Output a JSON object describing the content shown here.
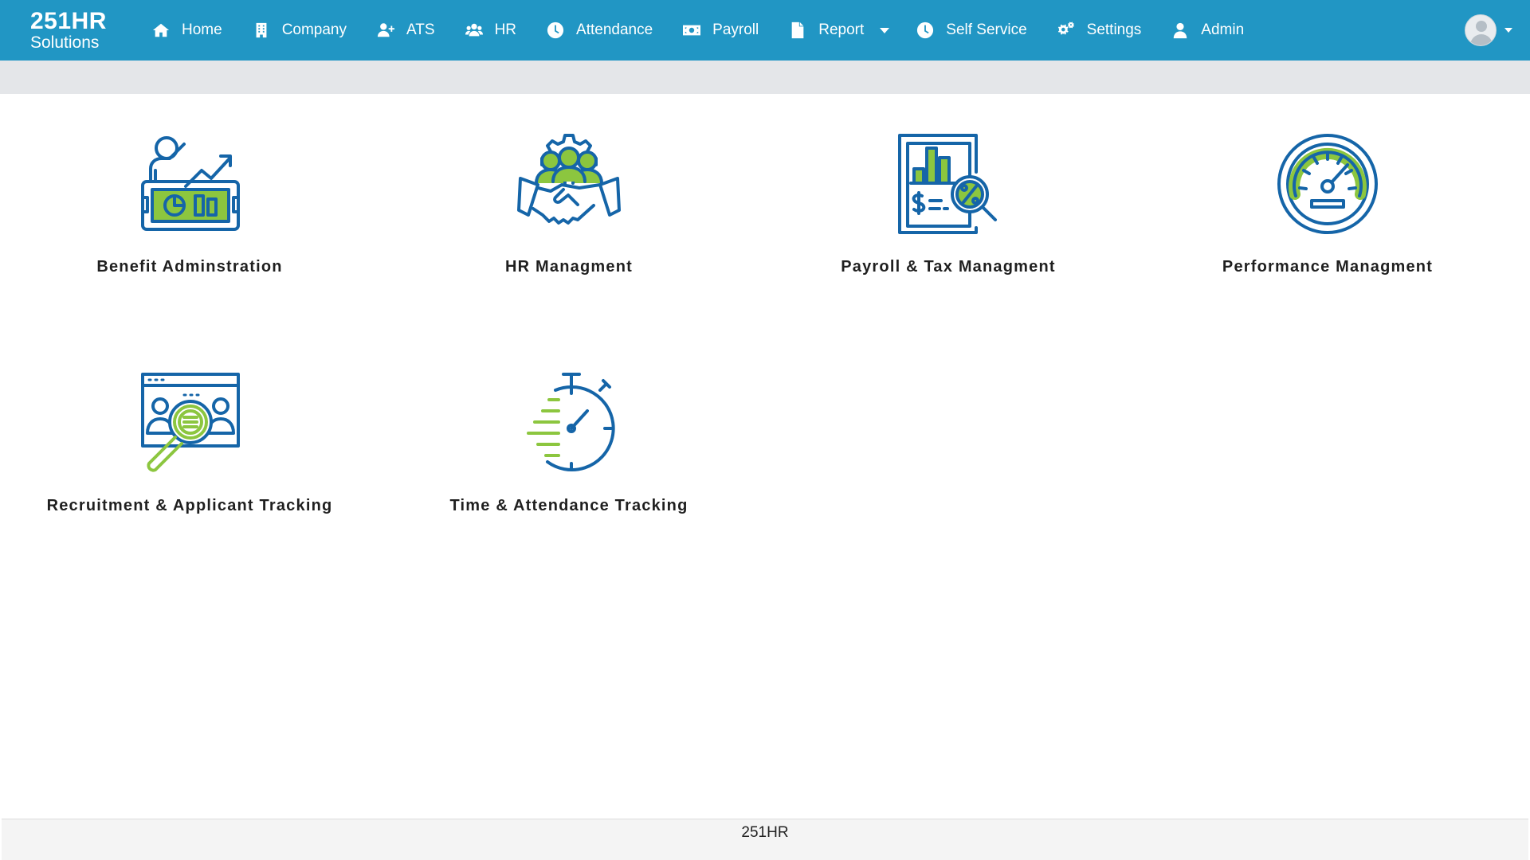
{
  "brand": {
    "line1": "251HR",
    "line2": "Solutions"
  },
  "nav": {
    "items": [
      {
        "label": "Home",
        "icon": "home-icon"
      },
      {
        "label": "Company",
        "icon": "building-icon"
      },
      {
        "label": "ATS",
        "icon": "user-plus-icon"
      },
      {
        "label": "HR",
        "icon": "users-icon"
      },
      {
        "label": "Attendance",
        "icon": "clock-icon"
      },
      {
        "label": "Payroll",
        "icon": "money-bill-icon"
      },
      {
        "label": "Report",
        "icon": "file-icon"
      },
      {
        "label": "Self Service",
        "icon": "clock-icon"
      },
      {
        "label": "Settings",
        "icon": "gears-icon"
      },
      {
        "label": "Admin",
        "icon": "user-icon"
      }
    ]
  },
  "modules": [
    {
      "label": "Benefit Adminstration",
      "icon": "benefit-presentation-icon"
    },
    {
      "label": "HR Managment",
      "icon": "team-handshake-icon"
    },
    {
      "label": "Payroll & Tax Managment",
      "icon": "tax-report-icon"
    },
    {
      "label": "Performance Managment",
      "icon": "speedometer-icon"
    },
    {
      "label": "Recruitment & Applicant Tracking",
      "icon": "recruitment-search-icon"
    },
    {
      "label": "Time & Attendance Tracking",
      "icon": "stopwatch-icon"
    }
  ],
  "footer": {
    "text": "251HR"
  },
  "colors": {
    "primary": "#2196c4",
    "icon_blue": "#1565a8",
    "icon_green": "#8cc63f"
  }
}
